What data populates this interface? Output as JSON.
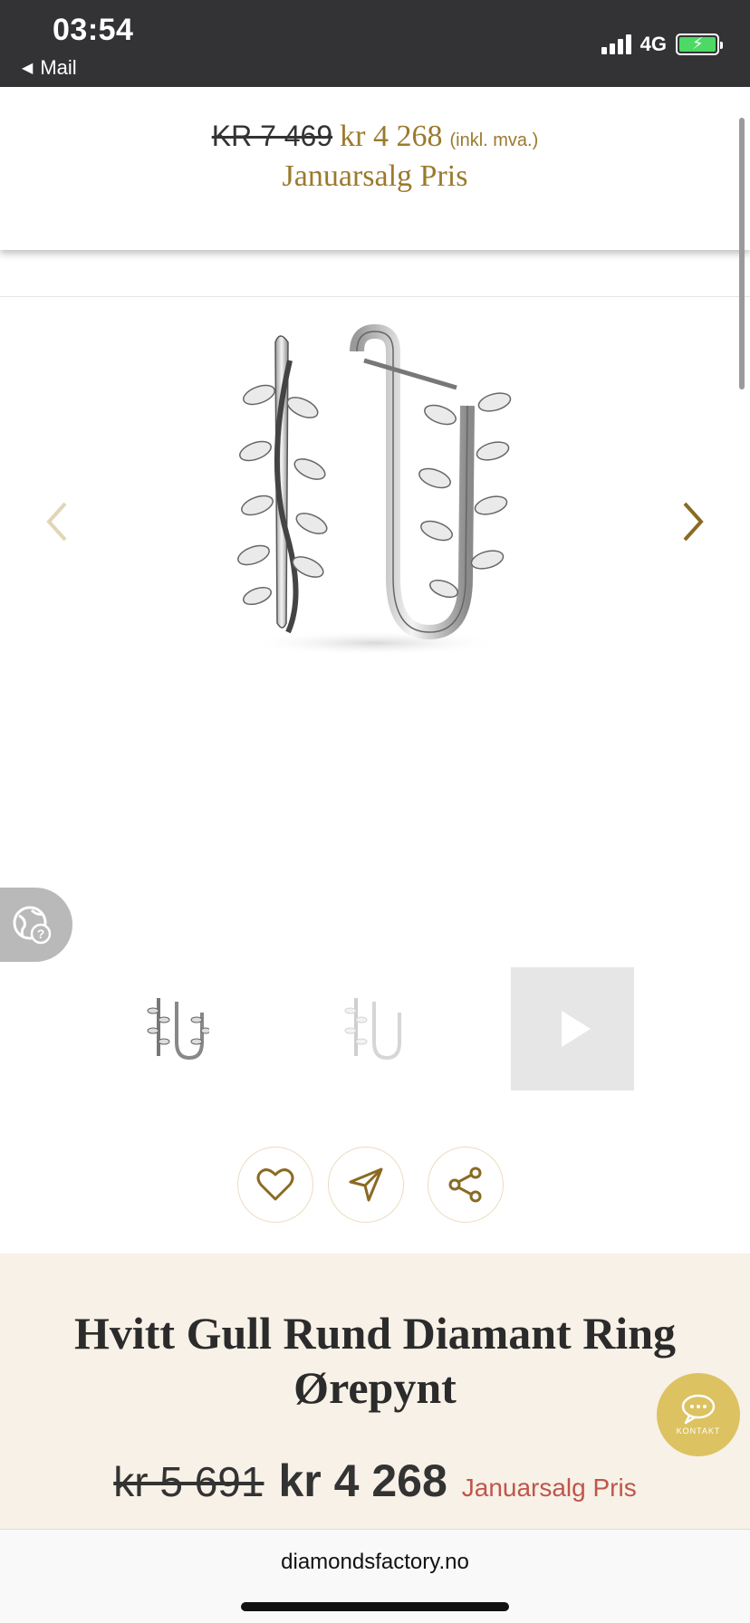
{
  "status_bar": {
    "time": "03:54",
    "back_app": "Mail",
    "network": "4G"
  },
  "sticky_price": {
    "old_price": "KR 7 469",
    "new_price": "kr 4 268",
    "vat_note": "(inkl. mva.)",
    "sale_label": "Januarsalg Pris"
  },
  "gallery": {
    "prev_icon": "chevron-left-icon",
    "next_icon": "chevron-right-icon",
    "thumbnails": [
      "earrings-front",
      "earrings-faded",
      "video-thumbnail"
    ]
  },
  "actions": {
    "favorite_icon": "heart-icon",
    "send_icon": "send-icon",
    "share_icon": "share-icon"
  },
  "product": {
    "title_line1": "Hvitt Gull Rund Diamant Ring",
    "title_line2": "Ørepynt",
    "old_price": "kr 5 691",
    "new_price": "kr 4 268",
    "sale_label": "Januarsalg Pris"
  },
  "kontakt": {
    "label": "KONTAKT"
  },
  "browser": {
    "url": "diamondsfactory.no"
  },
  "colors": {
    "gold": "#9a7a2d",
    "sale_red": "#c0554a",
    "panel_bg": "#f7f1e7",
    "kontakt_bg": "#dcc261",
    "status_bg": "#333335"
  }
}
